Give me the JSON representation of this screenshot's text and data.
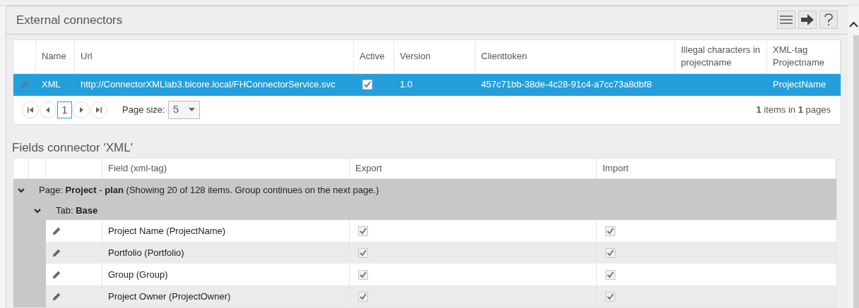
{
  "panel": {
    "title": "External connectors"
  },
  "connectors": {
    "columns": [
      "Name",
      "Url",
      "Active",
      "Version",
      "Clienttoken",
      "Illegal characters in projectname",
      "XML-tag Projectname"
    ],
    "rows": [
      {
        "name": "XML",
        "url": "http://ConnectorXMLlab3.bicore.local/FHConnectorService.svc",
        "active": true,
        "version": "1.0",
        "clienttoken": "457c71bb-38de-4c28-91c4-a7cc73a8dbf8",
        "xml_tag": "ProjectName",
        "selected": true
      }
    ],
    "pager": {
      "pages": [
        {
          "label": "1",
          "selected": true
        }
      ],
      "page_size_label": "Page size:",
      "page_size": "5",
      "summary": "**1** items in **1** pages"
    }
  },
  "fields": {
    "title": "Fields connector 'XML'",
    "columns": [
      "Field (xml-tag)",
      "Export",
      "Import"
    ],
    "group": {
      "text": "Page: **Project** - **plan** (Showing 20 of 128 items. Group continues on the next page.)",
      "expanded": true,
      "subgroup": {
        "text": "Tab: **Base**",
        "expanded": true,
        "rows": [
          {
            "field": "Project Name (ProjectName)",
            "export": true,
            "import": true
          },
          {
            "field": "Portfolio (Portfolio)",
            "export": true,
            "import": true
          },
          {
            "field": "Group (Group)",
            "export": true,
            "import": true
          },
          {
            "field": "Project Owner (ProjectOwner)",
            "export": true,
            "import": true
          }
        ]
      }
    }
  }
}
